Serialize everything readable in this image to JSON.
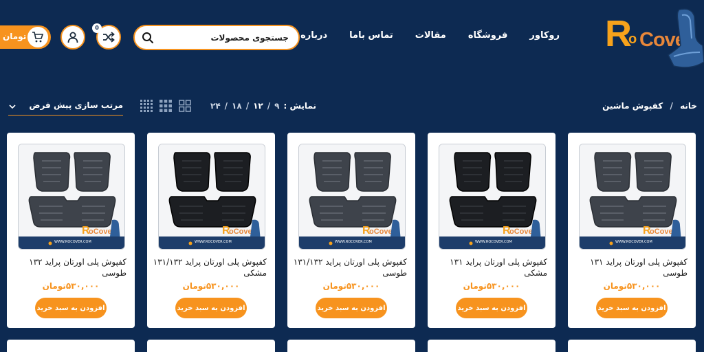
{
  "brand": {
    "logo_r": "R",
    "logo_o": "o",
    "logo_cover": "Cover"
  },
  "nav": [
    "روکاور",
    "فروشگاه",
    "مقالات",
    "تماس باما",
    "درباره ما"
  ],
  "search": {
    "placeholder": "جستجوی محصولات",
    "icon": "search-icon"
  },
  "header_actions": {
    "compare_count": "0",
    "cart_label": "تومان",
    "compare_icon": "shuffle-icon",
    "account_icon": "user-icon",
    "cart_icon": "cart-icon"
  },
  "breadcrumb": {
    "home": "خانه",
    "sep": "/",
    "current": "کفپوش ماشین"
  },
  "display": {
    "label": "نمایش :",
    "options": [
      "۹",
      "۱۲",
      "۱۸",
      "۲۴"
    ],
    "active": "۱۲",
    "sep": "/"
  },
  "sort": {
    "label": "مرتب سازی پیش فرض"
  },
  "colors": {
    "background": "#0d2a52",
    "accent": "#f7931e"
  },
  "products": [
    {
      "title": "کفپوش پلی اورتان پراید ۱۳۱ طوسی",
      "price": "۵۳۰,۰۰۰تومان",
      "button": "افزودن به سبد خرید",
      "mat_color": "gray",
      "watermark": "WWW.ROCOVER.COM"
    },
    {
      "title": "کفپوش پلی اورتان پراید ۱۳۱ مشکی",
      "price": "۵۳۰,۰۰۰تومان",
      "button": "افزودن به سبد خرید",
      "mat_color": "black",
      "watermark": "WWW.ROCOVER.COM"
    },
    {
      "title": "کفپوش پلی اورتان پراید ۱۳۱/۱۳۲ طوسی",
      "price": "۵۳۰,۰۰۰تومان",
      "button": "افزودن به سبد خرید",
      "mat_color": "gray",
      "watermark": "WWW.ROCOVER.COM"
    },
    {
      "title": "کفپوش پلی اورتان پراید ۱۳۱/۱۳۲ مشکی",
      "price": "۵۳۰,۰۰۰تومان",
      "button": "افزودن به سبد خرید",
      "mat_color": "black",
      "watermark": "WWW.ROCOVER.COM"
    },
    {
      "title": "کفپوش پلی اورتان پراید ۱۳۲ طوسی",
      "price": "۵۳۰,۰۰۰تومان",
      "button": "افزودن به سبد خرید",
      "mat_color": "gray",
      "watermark": "WWW.ROCOVER.COM"
    }
  ]
}
